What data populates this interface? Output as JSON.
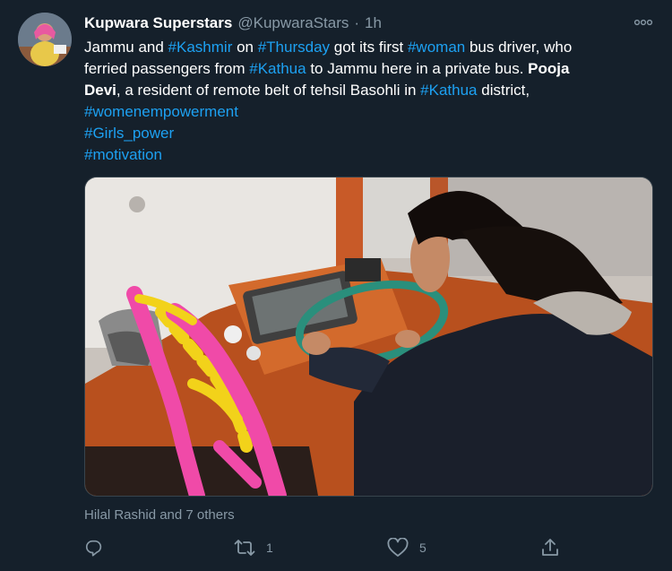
{
  "tweet": {
    "author_name": "Kupwara Superstars",
    "author_handle": "@KupwaraStars",
    "separator": "·",
    "time": "1h",
    "text": {
      "l1_a": "Jammu and ",
      "l1_tag1": "#Kashmir",
      "l1_b": " on ",
      "l1_tag2": "#Thursday",
      "l1_c": " got its first ",
      "l1_tag3": "#woman",
      "l1_d": " bus driver, who",
      "l2_a": "ferried passengers from ",
      "l2_tag": "#Kathua",
      "l2_b": " to Jammu here in a private bus. ",
      "l2_bold": "Pooja",
      "l3_bold": "Devi",
      "l3_a": ", a resident of remote belt of tehsil Basohli in ",
      "l3_tag": "#Kathua",
      "l3_b": " district,",
      "hashtag_1": "#womenempowerment",
      "hashtag_2": "#Girls_power",
      "hashtag_3": "#motivation"
    },
    "liked_by": "Hilal Rashid and 7 others",
    "actions": {
      "reply_icon": "reply-icon",
      "retweet_icon": "retweet-icon",
      "retweet_count": "1",
      "like_icon": "heart-icon",
      "like_count": "5",
      "share_icon": "share-icon"
    }
  },
  "colors": {
    "background": "#15202b",
    "link": "#1da1f2",
    "secondary_text": "#8899a6",
    "border": "#38444d"
  }
}
